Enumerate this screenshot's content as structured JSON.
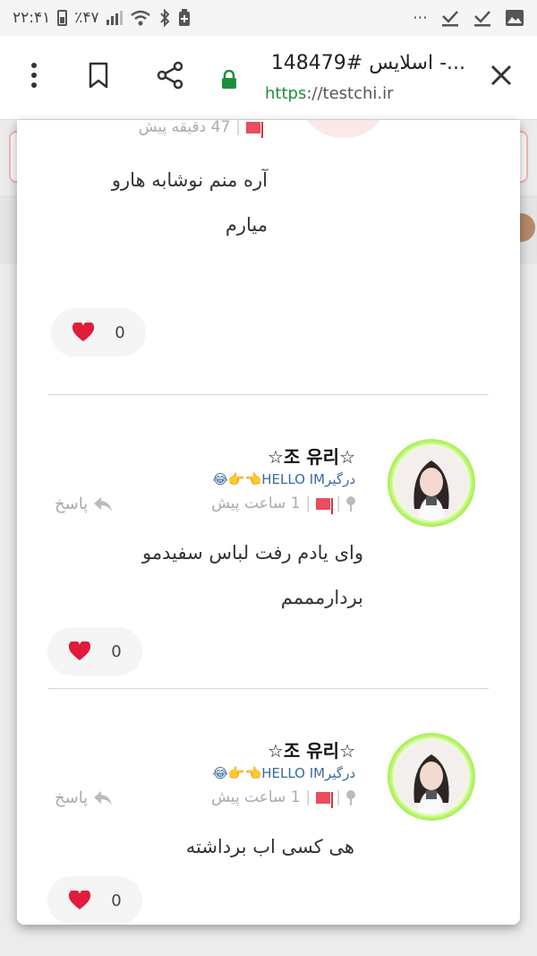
{
  "status_bar": {
    "time": "۲۲:۴۱",
    "battery": "٪۴۷",
    "more": "⋯"
  },
  "toolbar": {
    "title": "اسلایس #148479 -...",
    "url_scheme": "https",
    "url_host": "://testchi.ir"
  },
  "comments": [
    {
      "time": "47 دقیقه پیش",
      "text_lines": [
        "آره منم نوشابه هارو",
        "میارم"
      ],
      "likes": "0"
    },
    {
      "username": "☆조 유리☆",
      "subtitle": "درگیرHELLO IM👈👉😂",
      "time": "1 ساعت پیش",
      "reply_label": "پاسخ",
      "text_lines": [
        "وای یادم رفت لباس سفیدمو",
        "بردارمممم"
      ],
      "likes": "0"
    },
    {
      "username": "☆조 유리☆",
      "subtitle": "درگیرHELLO IM👈👉😂",
      "time": "1 ساعت پیش",
      "reply_label": "پاسخ",
      "text_lines": [
        "هی کسی اب برداشته"
      ],
      "likes": "0"
    }
  ],
  "colors": {
    "flag": "#e94d5f",
    "link": "#3b6a9c",
    "https": "#1e8e3e",
    "heart": "#e01b3c",
    "avatar_ring": "#7ee12a"
  }
}
